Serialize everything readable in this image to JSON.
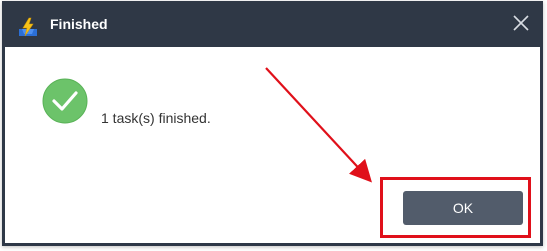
{
  "dialog": {
    "title": "Finished",
    "message": "1 task(s) finished.",
    "ok_label": "OK",
    "close_glyph": "×"
  },
  "icons": {
    "app": "lightning-app-icon",
    "close": "close-icon",
    "status": "check-circle-icon"
  },
  "colors": {
    "titlebar": "#2f3846",
    "ok_button": "#525c6b",
    "check": "#6cc36a",
    "annotation": "#e0101a"
  }
}
